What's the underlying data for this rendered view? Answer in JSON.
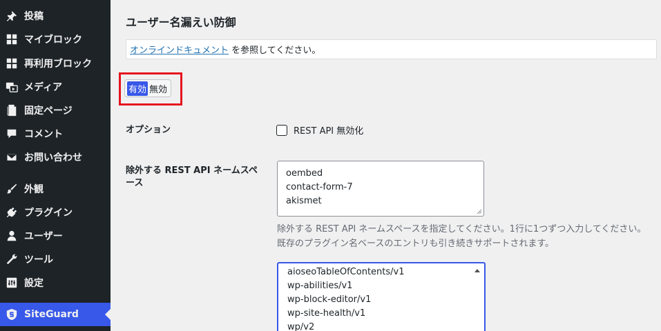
{
  "sidebar": {
    "items": [
      {
        "label": "投稿",
        "icon": "pin-icon"
      },
      {
        "label": "マイブロック",
        "icon": "blocks-icon"
      },
      {
        "label": "再利用ブロック",
        "icon": "blocks-icon"
      },
      {
        "label": "メディア",
        "icon": "media-icon"
      },
      {
        "label": "固定ページ",
        "icon": "pages-icon"
      },
      {
        "label": "コメント",
        "icon": "comment-icon"
      },
      {
        "label": "お問い合わせ",
        "icon": "mail-icon"
      },
      {
        "label": "外観",
        "icon": "brush-icon"
      },
      {
        "label": "プラグイン",
        "icon": "plugin-icon"
      },
      {
        "label": "ユーザー",
        "icon": "user-icon"
      },
      {
        "label": "ツール",
        "icon": "wrench-icon"
      },
      {
        "label": "設定",
        "icon": "settings-icon"
      },
      {
        "label": "SiteGuard",
        "icon": "siteguard-icon"
      }
    ]
  },
  "main": {
    "title": "ユーザー名漏えい防御",
    "notice": {
      "link_text": "オンラインドキュメント",
      "suffix_text": " を参照してください。"
    },
    "toggle": {
      "on_label": "有効",
      "off_label": "無効"
    },
    "option": {
      "label": "オプション",
      "checkbox_label": "REST API 無効化"
    },
    "exclude": {
      "label": "除外する REST API ネームスペース",
      "textarea_lines": [
        "oembed",
        "contact-form-7",
        "akismet"
      ],
      "help_text": "除外する REST API ネームスペースを指定してください。1行に1つずつ入力してください。既存のプラグイン名ベースのエントリも引き続きサポートされます。"
    },
    "namespace_list": [
      "aioseoTableOfContents/v1",
      "wp-abilities/v1",
      "wp-block-editor/v1",
      "wp-site-health/v1",
      "wp/v2"
    ]
  },
  "colors": {
    "sidebar_bg": "#1d2327",
    "accent": "#3858e9",
    "highlight_border": "#e5141e"
  }
}
